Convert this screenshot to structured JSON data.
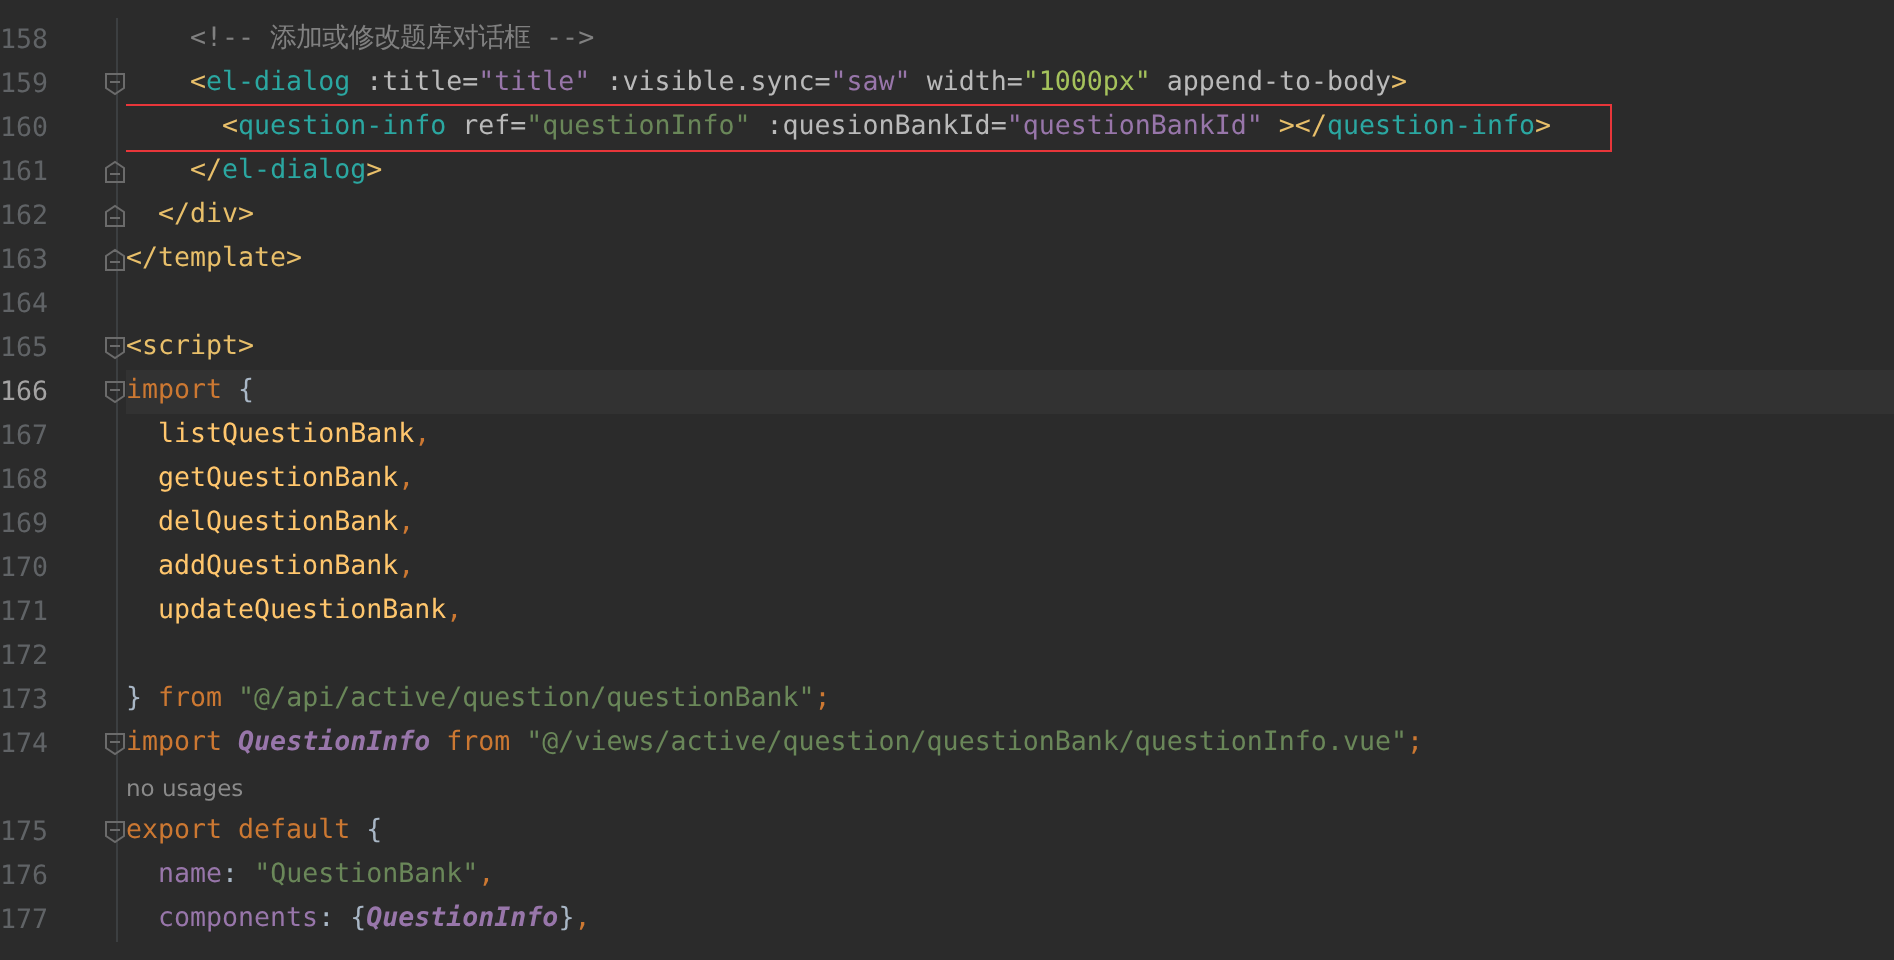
{
  "editor": {
    "lines": [
      {
        "kind": "code",
        "number": "158",
        "fold_open": false,
        "fold_close": false,
        "current": false,
        "boxed": false,
        "tokens": [
          {
            "kind": "comment",
            "text": "    <!-- 添加或修改题库对话框 -->"
          }
        ]
      },
      {
        "kind": "code",
        "number": "159",
        "fold_open": true,
        "fold_close": false,
        "current": false,
        "boxed": false,
        "tokens": [
          {
            "kind": "bracket",
            "text": "    <"
          },
          {
            "kind": "tag",
            "text": "el-dialog"
          },
          {
            "kind": "attr",
            "text": " :title="
          },
          {
            "kind": "strv",
            "text": "\"title\""
          },
          {
            "kind": "attr",
            "text": " :visible.sync="
          },
          {
            "kind": "strv",
            "text": "\"saw\""
          },
          {
            "kind": "attr",
            "text": " width="
          },
          {
            "kind": "strn",
            "text": "\"1000px\""
          },
          {
            "kind": "attr",
            "text": " append-to-body"
          },
          {
            "kind": "bracket",
            "text": ">"
          }
        ]
      },
      {
        "kind": "code",
        "number": "160",
        "fold_open": false,
        "fold_close": false,
        "current": false,
        "boxed": true,
        "tokens": [
          {
            "kind": "bracket",
            "text": "      <"
          },
          {
            "kind": "tag",
            "text": "question-info"
          },
          {
            "kind": "attr",
            "text": " ref="
          },
          {
            "kind": "str",
            "text": "\"questionInfo\""
          },
          {
            "kind": "attr",
            "text": " :quesionBankId="
          },
          {
            "kind": "strv",
            "text": "\"questionBankId\""
          },
          {
            "kind": "bracket",
            "text": " ></"
          },
          {
            "kind": "tag",
            "text": "question-info"
          },
          {
            "kind": "bracket",
            "text": ">"
          }
        ]
      },
      {
        "kind": "code",
        "number": "161",
        "fold_open": false,
        "fold_close": true,
        "current": false,
        "boxed": false,
        "tokens": [
          {
            "kind": "bracket",
            "text": "    </"
          },
          {
            "kind": "tag",
            "text": "el-dialog"
          },
          {
            "kind": "bracket",
            "text": ">"
          }
        ]
      },
      {
        "kind": "code",
        "number": "162",
        "fold_open": false,
        "fold_close": true,
        "current": false,
        "boxed": false,
        "tokens": [
          {
            "kind": "bracket",
            "text": "  </div>"
          }
        ]
      },
      {
        "kind": "code",
        "number": "163",
        "fold_open": false,
        "fold_close": true,
        "current": false,
        "boxed": false,
        "tokens": [
          {
            "kind": "bracket",
            "text": "</template>"
          }
        ]
      },
      {
        "kind": "code",
        "number": "164",
        "fold_open": false,
        "fold_close": false,
        "current": false,
        "boxed": false
      },
      {
        "kind": "code",
        "number": "165",
        "fold_open": true,
        "fold_close": false,
        "current": false,
        "boxed": false,
        "tokens": [
          {
            "kind": "bracket",
            "text": "<script>"
          }
        ]
      },
      {
        "kind": "code",
        "number": "166",
        "fold_open": true,
        "fold_close": false,
        "current": true,
        "boxed": false,
        "tokens": [
          {
            "kind": "kw",
            "text": "import "
          },
          {
            "kind": "brace",
            "text": "{"
          }
        ]
      },
      {
        "kind": "code",
        "number": "167",
        "fold_open": false,
        "fold_close": false,
        "current": false,
        "boxed": false,
        "tokens": [
          {
            "kind": "fn",
            "text": "  listQuestionBank"
          },
          {
            "kind": "punct",
            "text": ","
          }
        ]
      },
      {
        "kind": "code",
        "number": "168",
        "fold_open": false,
        "fold_close": false,
        "current": false,
        "boxed": false,
        "tokens": [
          {
            "kind": "fn",
            "text": "  getQuestionBank"
          },
          {
            "kind": "punct",
            "text": ","
          }
        ]
      },
      {
        "kind": "code",
        "number": "169",
        "fold_open": false,
        "fold_close": false,
        "current": false,
        "boxed": false,
        "tokens": [
          {
            "kind": "fn",
            "text": "  delQuestionBank"
          },
          {
            "kind": "punct",
            "text": ","
          }
        ]
      },
      {
        "kind": "code",
        "number": "170",
        "fold_open": false,
        "fold_close": false,
        "current": false,
        "boxed": false,
        "tokens": [
          {
            "kind": "fn",
            "text": "  addQuestionBank"
          },
          {
            "kind": "punct",
            "text": ","
          }
        ]
      },
      {
        "kind": "code",
        "number": "171",
        "fold_open": false,
        "fold_close": false,
        "current": false,
        "boxed": false,
        "tokens": [
          {
            "kind": "fn",
            "text": "  updateQuestionBank"
          },
          {
            "kind": "punct",
            "text": ","
          }
        ]
      },
      {
        "kind": "code",
        "number": "172",
        "fold_open": false,
        "fold_close": false,
        "current": false,
        "boxed": false
      },
      {
        "kind": "code",
        "number": "173",
        "fold_open": false,
        "fold_close": false,
        "current": false,
        "boxed": false,
        "tokens": [
          {
            "kind": "brace",
            "text": "} "
          },
          {
            "kind": "kw",
            "text": "from "
          },
          {
            "kind": "str",
            "text": "\"@/api/active/question/questionBank\""
          },
          {
            "kind": "punct",
            "text": ";"
          }
        ]
      },
      {
        "kind": "code",
        "number": "174",
        "fold_open": true,
        "fold_close": false,
        "current": false,
        "boxed": false,
        "tokens": [
          {
            "kind": "kw",
            "text": "import "
          },
          {
            "kind": "cls",
            "text": "QuestionInfo"
          },
          {
            "kind": "kw",
            "text": " from "
          },
          {
            "kind": "str",
            "text": "\"@/views/active/question/questionBank/questionInfo.vue\""
          },
          {
            "kind": "punct",
            "text": ";"
          }
        ]
      },
      {
        "kind": "hint",
        "text": "no usages"
      },
      {
        "kind": "code",
        "number": "175",
        "fold_open": true,
        "fold_close": false,
        "current": false,
        "boxed": false,
        "tokens": [
          {
            "kind": "kw",
            "text": "export default "
          },
          {
            "kind": "brace",
            "text": "{"
          }
        ]
      },
      {
        "kind": "code",
        "number": "176",
        "fold_open": false,
        "fold_close": false,
        "current": false,
        "boxed": false,
        "tokens": [
          {
            "kind": "prop",
            "text": "  name"
          },
          {
            "kind": "brace",
            "text": ": "
          },
          {
            "kind": "str",
            "text": "\"QuestionBank\""
          },
          {
            "kind": "punct",
            "text": ","
          }
        ]
      },
      {
        "kind": "code",
        "number": "177",
        "fold_open": false,
        "fold_close": false,
        "current": false,
        "boxed": false,
        "tokens": [
          {
            "kind": "prop",
            "text": "  components"
          },
          {
            "kind": "brace",
            "text": ": {"
          },
          {
            "kind": "cls",
            "text": "QuestionInfo"
          },
          {
            "kind": "brace",
            "text": "}"
          },
          {
            "kind": "punct",
            "text": ","
          }
        ]
      }
    ]
  }
}
